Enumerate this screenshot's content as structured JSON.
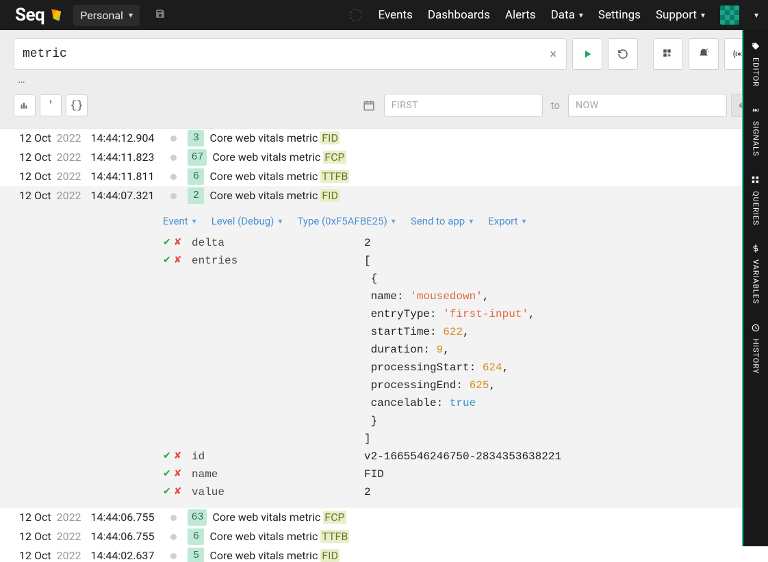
{
  "brand": {
    "name": "Seq"
  },
  "workspace": {
    "name": "Personal"
  },
  "nav": {
    "events": "Events",
    "dashboards": "Dashboards",
    "alerts": "Alerts",
    "data": "Data",
    "settings": "Settings",
    "support": "Support"
  },
  "search": {
    "query": "metric",
    "placeholder_from": "FIRST",
    "placeholder_to": "NOW",
    "to_label": "to"
  },
  "detail_actions": {
    "event": "Event",
    "level": "Level (Debug)",
    "type": "Type (0xF5AFBE25)",
    "send": "Send to app",
    "export": "Export"
  },
  "events": [
    {
      "date": "12 Oct",
      "year": "2022",
      "time": "14:44:12.904",
      "badge": "3",
      "msg": "Core web vitals metric ",
      "metric": "FID"
    },
    {
      "date": "12 Oct",
      "year": "2022",
      "time": "14:44:11.823",
      "badge": "67",
      "msg": "Core web vitals metric ",
      "metric": "FCP"
    },
    {
      "date": "12 Oct",
      "year": "2022",
      "time": "14:44:11.811",
      "badge": "6",
      "msg": "Core web vitals metric ",
      "metric": "TTFB"
    },
    {
      "date": "12 Oct",
      "year": "2022",
      "time": "14:44:07.321",
      "badge": "2",
      "msg": "Core web vitals metric ",
      "metric": "FID",
      "expanded": true
    },
    {
      "date": "12 Oct",
      "year": "2022",
      "time": "14:44:06.755",
      "badge": "63",
      "msg": "Core web vitals metric ",
      "metric": "FCP"
    },
    {
      "date": "12 Oct",
      "year": "2022",
      "time": "14:44:06.755",
      "badge": "6",
      "msg": "Core web vitals metric ",
      "metric": "TTFB"
    },
    {
      "date": "12 Oct",
      "year": "2022",
      "time": "14:44:02.637",
      "badge": "5",
      "msg": "Core web vitals metric ",
      "metric": "FID"
    }
  ],
  "expanded_props": {
    "delta": "2",
    "entries_label": "entries",
    "id": "v2-1665546246750-2834353638221",
    "name": "FID",
    "value": "2"
  },
  "entries_json": {
    "open_bracket": "[",
    "open_brace": "  {",
    "l1": {
      "key": "    name: ",
      "str": "'mousedown'",
      "tail": ","
    },
    "l2": {
      "key": "    entryType: ",
      "str": "'first-input'",
      "tail": ","
    },
    "l3": {
      "key": "    startTime: ",
      "num": "622",
      "tail": ","
    },
    "l4": {
      "key": "    duration: ",
      "num": "9",
      "tail": ","
    },
    "l5": {
      "key": "    processingStart: ",
      "num": "624",
      "tail": ","
    },
    "l6": {
      "key": "    processingEnd: ",
      "num": "625",
      "tail": ","
    },
    "l7": {
      "key": "    cancelable: ",
      "bool": "true",
      "tail": ""
    },
    "close_brace": "  }",
    "close_bracket": "]"
  },
  "sidebar": {
    "editor": "EDITOR",
    "signals": "SIGNALS",
    "queries": "QUERIES",
    "variables": "VARIABLES",
    "history": "HISTORY"
  }
}
